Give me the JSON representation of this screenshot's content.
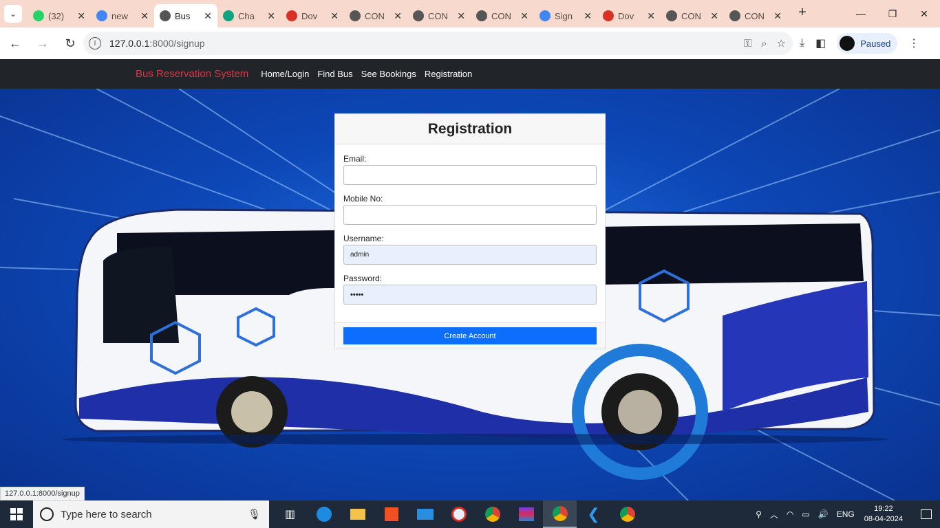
{
  "browser": {
    "tabs": [
      {
        "title": "(32)",
        "icon": "whatsapp-icon",
        "color": "#25d366"
      },
      {
        "title": "new",
        "icon": "google-icon",
        "color": "#4285f4"
      },
      {
        "title": "Bus",
        "icon": "globe-icon",
        "color": "#555555"
      },
      {
        "title": "Cha",
        "icon": "chatgpt-icon",
        "color": "#10a37f"
      },
      {
        "title": "Dov",
        "icon": "heart-icon",
        "color": "#d93025"
      },
      {
        "title": "CON",
        "icon": "globe-icon",
        "color": "#555555"
      },
      {
        "title": "CON",
        "icon": "globe-icon",
        "color": "#555555"
      },
      {
        "title": "CON",
        "icon": "globe-icon",
        "color": "#555555"
      },
      {
        "title": "Sign",
        "icon": "google-icon",
        "color": "#4285f4"
      },
      {
        "title": "Dov",
        "icon": "heart-icon",
        "color": "#d93025"
      },
      {
        "title": "CON",
        "icon": "globe-icon",
        "color": "#555555"
      },
      {
        "title": "CON",
        "icon": "globe-icon",
        "color": "#555555"
      }
    ],
    "active_tab": 2,
    "url_host": "127.0.0.1",
    "url_path": ":8000/signup",
    "profile_label": "Paused",
    "status_url": "127.0.0.1:8000/signup"
  },
  "site": {
    "brand": "Bus Reservation System",
    "nav": [
      "Home/Login",
      "Find Bus",
      "See Bookings",
      "Registration"
    ]
  },
  "form": {
    "title": "Registration",
    "email_label": "Email:",
    "email_value": "",
    "mobile_label": "Mobile No:",
    "mobile_value": "",
    "username_label": "Username:",
    "username_value": "admin",
    "password_label": "Password:",
    "password_value": "•••••",
    "submit_label": "Create Account"
  },
  "taskbar": {
    "search_placeholder": "Type here to search",
    "language": "ENG",
    "time": "19:22",
    "date": "08-04-2024"
  },
  "colors": {
    "brand_red": "#dc3545",
    "primary_button": "#0d6efd",
    "navbar_bg": "#212529",
    "tabstrip_bg": "#f7d9ce"
  }
}
